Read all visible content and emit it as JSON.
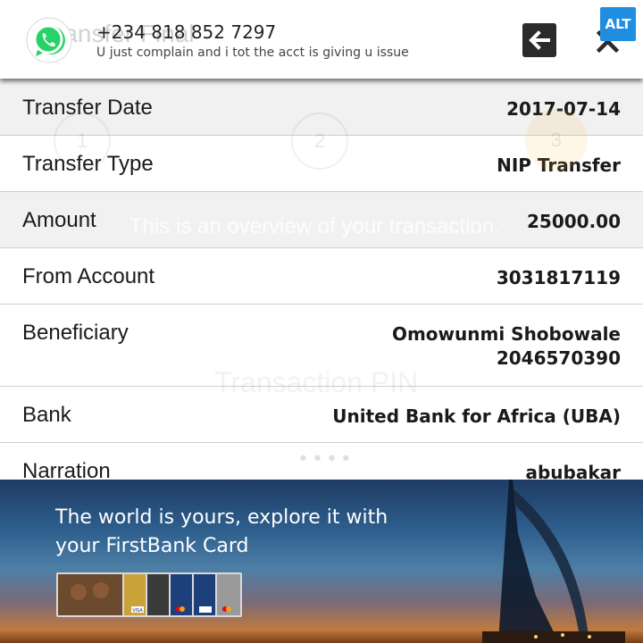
{
  "notification": {
    "app_icon": "whatsapp-icon",
    "ghost_title": "ransfer Final",
    "sender": "+234 818 852 7297",
    "message": "U just complain and i tot the acct is giving u issue",
    "back_icon": "arrow-left-icon",
    "close_icon": "close-icon",
    "alt_label": "ALT"
  },
  "background": {
    "steps": [
      "1",
      "2",
      "3"
    ],
    "overview_text": "This is an overview of your transaction.",
    "pin_label": "Transaction PIN",
    "pin_mask": "••••"
  },
  "details": [
    {
      "label": "Transfer Date",
      "values": [
        "2017-07-14"
      ]
    },
    {
      "label": "Transfer Type",
      "values": [
        "NIP Transfer"
      ]
    },
    {
      "label": "Amount",
      "values": [
        "25000.00"
      ]
    },
    {
      "label": "From Account",
      "values": [
        "3031817119"
      ]
    },
    {
      "label": "Beneficiary",
      "values": [
        "Omowunmi Shobowale",
        "2046570390"
      ]
    },
    {
      "label": "Bank",
      "values": [
        "United Bank for Africa (UBA)"
      ]
    },
    {
      "label": "Narration",
      "values": [
        "abubakar"
      ]
    }
  ],
  "ad": {
    "line1": "The world is yours, explore it with",
    "line2": "your FirstBank Card",
    "card_brand": "VISA",
    "colors": {
      "sky_top": "#1e3b63",
      "sunset": "#c07a3e"
    }
  },
  "colors": {
    "alt_badge": "#1f8ee0",
    "whatsapp_green": "#25d366",
    "row_grey": "#f1f1f1",
    "row_white": "#ffffff"
  }
}
